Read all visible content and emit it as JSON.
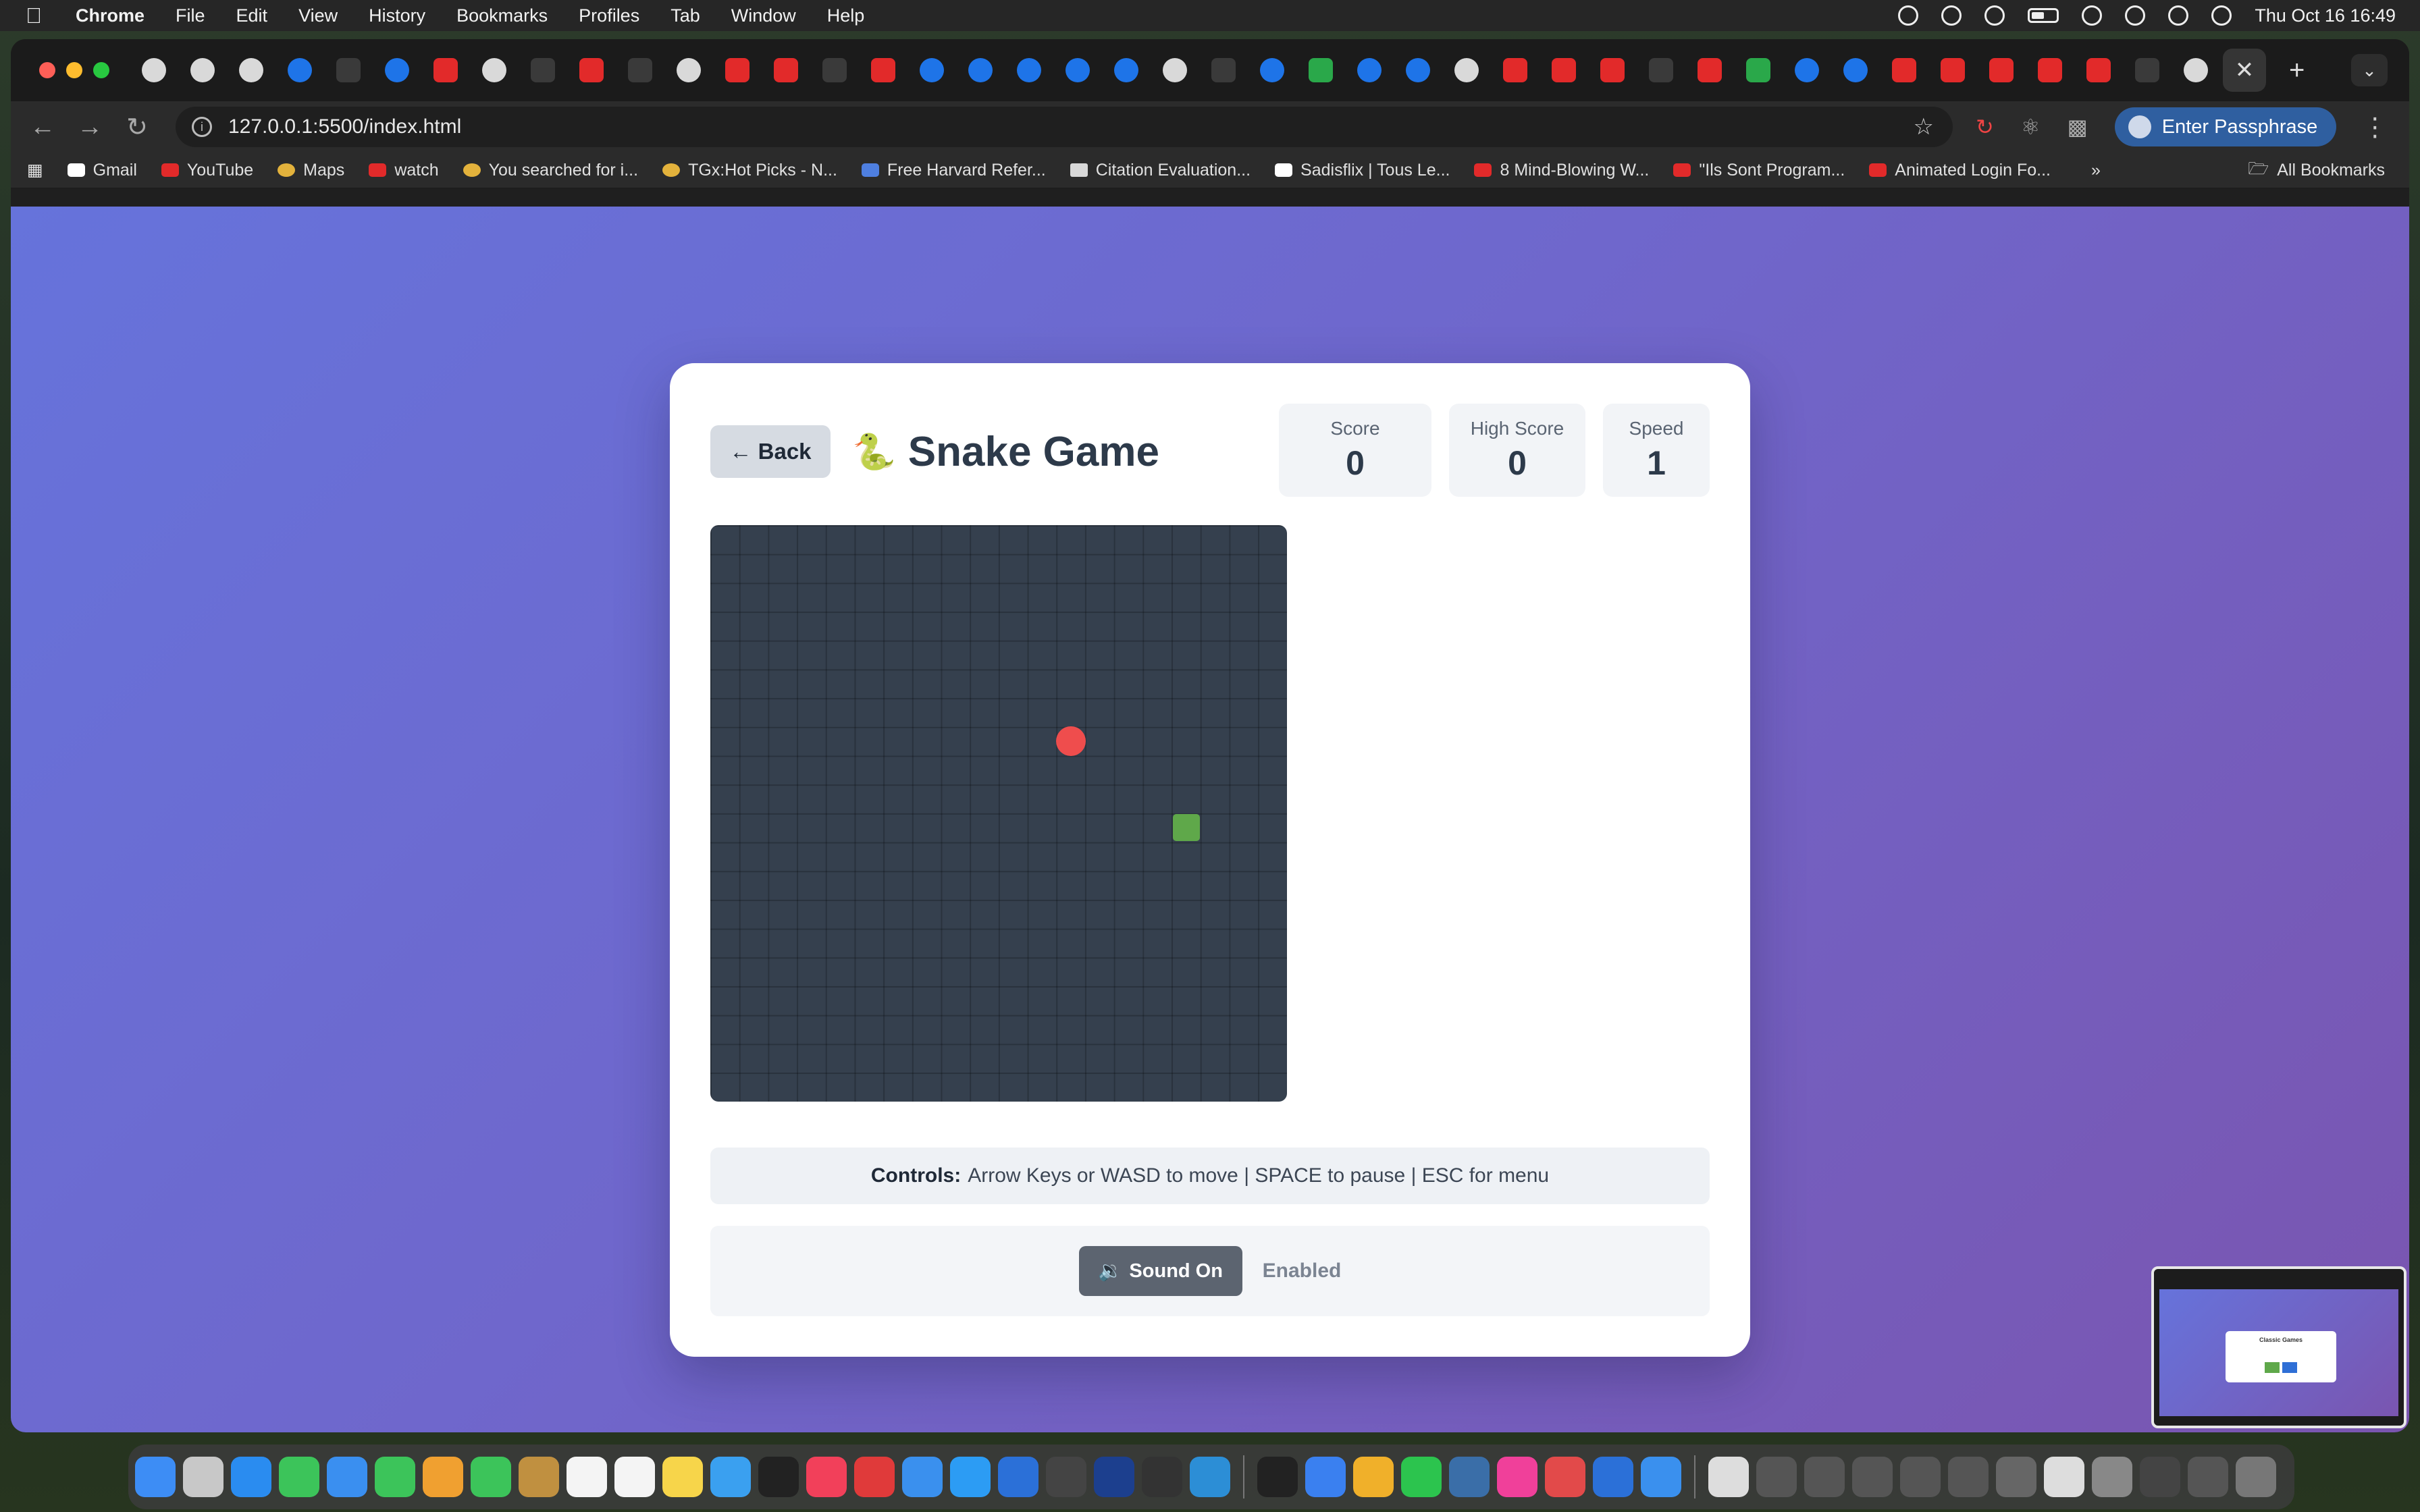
{
  "menubar": {
    "app": "Chrome",
    "items": [
      "File",
      "Edit",
      "View",
      "History",
      "Bookmarks",
      "Profiles",
      "Tab",
      "Window",
      "Help"
    ],
    "datetime": "Thu Oct 16  16:49"
  },
  "browser": {
    "url": "127.0.0.1:5500/index.html",
    "passphrase_button": "Enter Passphrase",
    "bookmarks": [
      {
        "label": "Gmail",
        "icon": "gmail-icon"
      },
      {
        "label": "YouTube",
        "icon": "youtube-icon"
      },
      {
        "label": "Maps",
        "icon": "maps-icon"
      },
      {
        "label": "watch",
        "icon": "youtube-icon"
      },
      {
        "label": "You searched for i...",
        "icon": "g-icon"
      },
      {
        "label": "TGx:Hot Picks - N...",
        "icon": "tgx-icon"
      },
      {
        "label": "Free Harvard Refer...",
        "icon": "bookmark-icon"
      },
      {
        "label": "Citation Evaluation...",
        "icon": "doc-icon"
      },
      {
        "label": "Sadisflix | Tous Le...",
        "icon": "page-icon"
      },
      {
        "label": "8 Mind-Blowing W...",
        "icon": "youtube-icon"
      },
      {
        "label": "\"Ils Sont Program...",
        "icon": "youtube-icon"
      },
      {
        "label": "Animated Login Fo...",
        "icon": "youtube-icon"
      }
    ],
    "all_bookmarks": "All Bookmarks"
  },
  "game": {
    "back_label": "← Back",
    "title": "Snake Game",
    "title_icon": "🐍",
    "stats": [
      {
        "label": "Score",
        "value": "0"
      },
      {
        "label": "High Score",
        "value": "0"
      },
      {
        "label": "Speed",
        "value": "1"
      }
    ],
    "grid_size": 20,
    "food_cell": [
      12,
      7
    ],
    "snake_cells": [
      [
        16,
        10
      ]
    ],
    "controls_label": "Controls:",
    "controls_text": "Arrow Keys or WASD to move | SPACE to pause | ESC for menu",
    "sound_button": "Sound On",
    "sound_icon": "🔉",
    "sound_status": "Enabled"
  },
  "pip": {
    "title": "Classic Games"
  }
}
